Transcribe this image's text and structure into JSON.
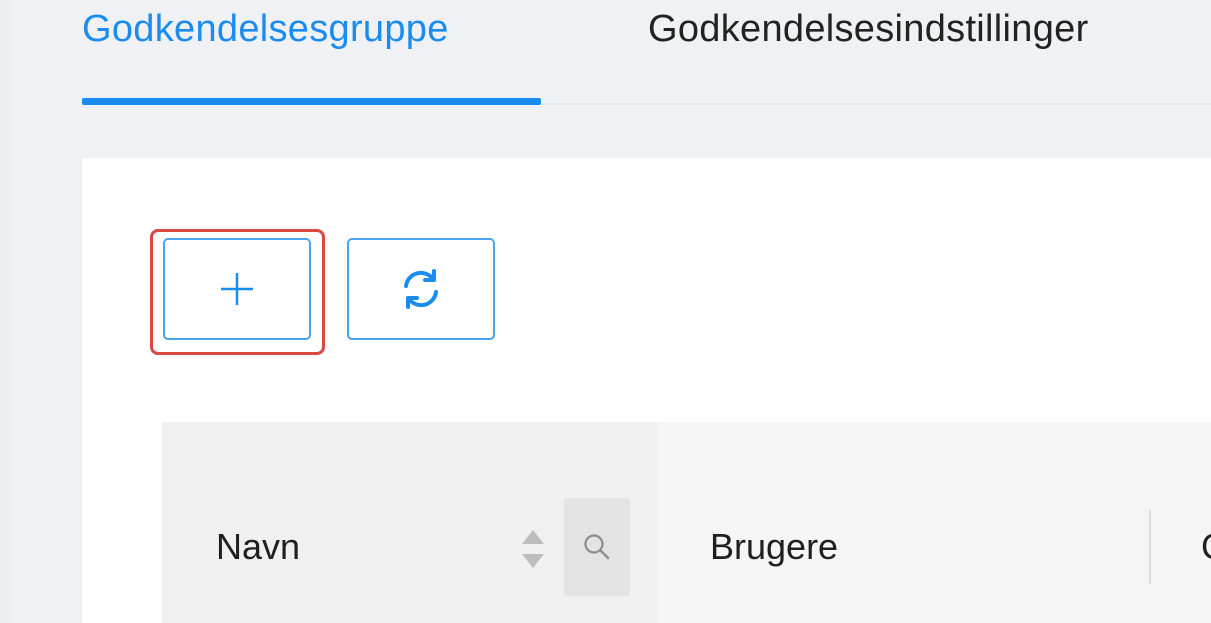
{
  "tabs": [
    {
      "label": "Godkendelsesgruppe",
      "active": true
    },
    {
      "label": "Godkendelsesindstillinger",
      "active": false
    }
  ],
  "toolbar": {
    "add_icon": "plus-icon",
    "refresh_icon": "refresh-icon"
  },
  "table": {
    "columns": [
      {
        "label": "Navn",
        "sortable": true,
        "searchable": true
      },
      {
        "label": "Brugere"
      },
      {
        "label": "G"
      }
    ]
  },
  "colors": {
    "accent": "#1a8cf0",
    "highlight": "#d9493e",
    "button_border": "#4aa3f0"
  }
}
